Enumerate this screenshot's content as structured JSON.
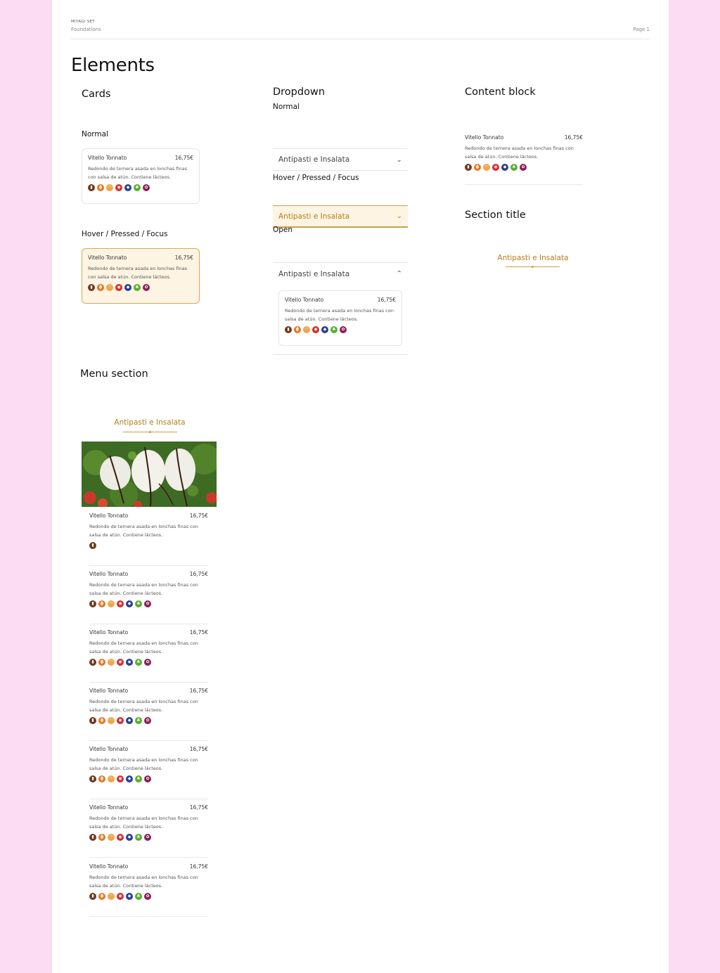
{
  "header": {
    "set": "MIYAGI SET",
    "subtitle": "Foundations",
    "page": "Page 1"
  },
  "title": "Elements",
  "cards": {
    "heading": "Cards",
    "normal_label": "Normal",
    "hover_label": "Hover / Pressed / Focus"
  },
  "dropdown": {
    "heading": "Dropdown",
    "normal_label": "Normal",
    "hover_label": "Hover / Pressed / Focus",
    "open_label": "Open",
    "label": "Antipasti e Insalata"
  },
  "content_block": {
    "heading": "Content block"
  },
  "section_title": {
    "heading": "Section title",
    "text": "Antipasti e Insalata"
  },
  "menu_section": {
    "heading": "Menu section",
    "title": "Antipasti e Insalata"
  },
  "item": {
    "name": "Vitello Tonnato",
    "price": "16,75€",
    "description_card": "Redondo de ternera asada en lonchas finas con salsa de atún. Contiene lácteos.",
    "description_wide": "Redondo de ternera asada en lonchas finas con salsa de atún. Contiene lácteos."
  },
  "allergen_icons": [
    {
      "name": "dairy-icon",
      "color": "#6d3a1f",
      "glyph": "▮"
    },
    {
      "name": "gluten-icon",
      "color": "#e8731f",
      "glyph": "ɸ"
    },
    {
      "name": "egg-icon",
      "color": "#f0a54a",
      "glyph": "◠"
    },
    {
      "name": "nuts-icon",
      "color": "#d42b2b",
      "glyph": "◉"
    },
    {
      "name": "fish-icon",
      "color": "#2a3f8f",
      "glyph": "◆"
    },
    {
      "name": "celery-icon",
      "color": "#58b030",
      "glyph": "♣"
    },
    {
      "name": "sulphite-icon",
      "color": "#8b1f5a",
      "glyph": "✿"
    }
  ],
  "colors": {
    "accent": "#b37d16",
    "hover_bg": "#fdf4e3",
    "page_bg": "#fbdcf3"
  }
}
